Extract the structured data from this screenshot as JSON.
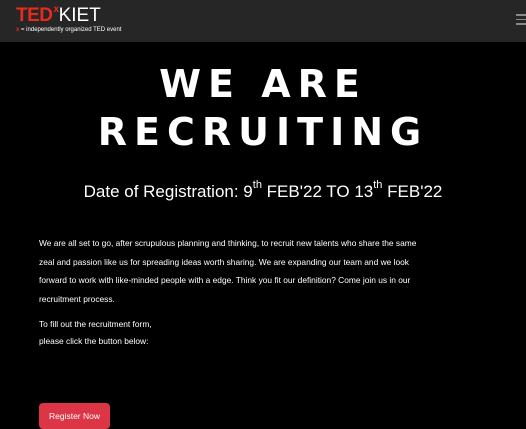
{
  "navbar": {
    "logo": {
      "ted": "TED",
      "x": "x",
      "name": "KIET",
      "tagline_x": "x",
      "tagline": " = independently organized TED event"
    },
    "menu_icon": "hamburger-menu-icon"
  },
  "hero": {
    "line1": "WE ARE",
    "line2": "RECRUITING"
  },
  "registration": {
    "label": "Date of Registration: 9",
    "start_suffix": "th",
    "start_rest": " FEB'22 TO 13",
    "end_suffix": "th",
    "end_rest": " FEB'22"
  },
  "intro_text": "We are all set to go, after scrupulous planning and thinking, to recruit new talents who share the same zeal and passion like us for spreading ideas worth sharing. We are expanding our team and we look forward to work with like-minded people with a edge. Think you fit our definition? Come join us in our recruitment process.",
  "form_instructions": {
    "line1": "To fill out the recruitment form,",
    "line2": "please click the button below:"
  },
  "register_button": "Register Now",
  "colors": {
    "navbar_bg": "#262626",
    "page_bg": "#000000",
    "ted_red": "#e62b1e",
    "button_red": "#dc3545"
  }
}
